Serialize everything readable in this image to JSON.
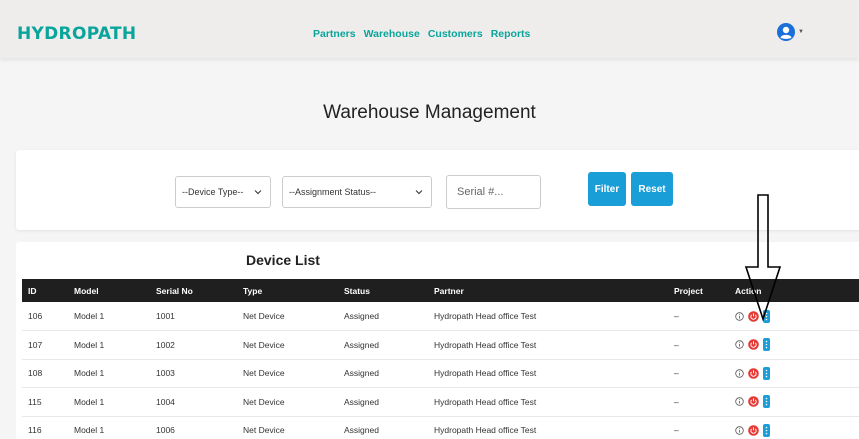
{
  "header": {
    "brand": "HYDROPATH",
    "nav": [
      {
        "label": "Partners"
      },
      {
        "label": "Warehouse"
      },
      {
        "label": "Customers"
      },
      {
        "label": "Reports"
      }
    ],
    "user_icon": "user-circle-icon"
  },
  "page": {
    "title": "Warehouse Management"
  },
  "filters": {
    "device_type": "--Device Type--",
    "assignment_status": "--Assignment Status--",
    "serial_placeholder": "Serial #...",
    "filter_label": "Filter",
    "reset_label": "Reset"
  },
  "device_list": {
    "title": "Device List",
    "columns": [
      "ID",
      "Model",
      "Serial No",
      "Type",
      "Status",
      "Partner",
      "Project",
      "Action"
    ],
    "rows": [
      {
        "id": "106",
        "model": "Model 1",
        "serial": "1001",
        "type": "Net Device",
        "status": "Assigned",
        "partner": "Hydropath Head office Test",
        "project": "–"
      },
      {
        "id": "107",
        "model": "Model 1",
        "serial": "1002",
        "type": "Net Device",
        "status": "Assigned",
        "partner": "Hydropath Head office Test",
        "project": "–"
      },
      {
        "id": "108",
        "model": "Model 1",
        "serial": "1003",
        "type": "Net Device",
        "status": "Assigned",
        "partner": "Hydropath Head office Test",
        "project": "–"
      },
      {
        "id": "115",
        "model": "Model 1",
        "serial": "1004",
        "type": "Net Device",
        "status": "Assigned",
        "partner": "Hydropath Head office Test",
        "project": "–"
      },
      {
        "id": "116",
        "model": "Model 1",
        "serial": "1006",
        "type": "Net Device",
        "status": "Assigned",
        "partner": "Hydropath Head office Test",
        "project": "–"
      }
    ]
  },
  "colors": {
    "brand": "#0aa59a",
    "primary_button": "#1a9ed8",
    "table_header": "#1f1f1f",
    "power_icon": "#e53935"
  },
  "icons": {
    "info": "info-circle-icon",
    "power": "power-icon",
    "more": "vertical-ellipsis-icon",
    "chevron": "chevron-down-icon"
  }
}
